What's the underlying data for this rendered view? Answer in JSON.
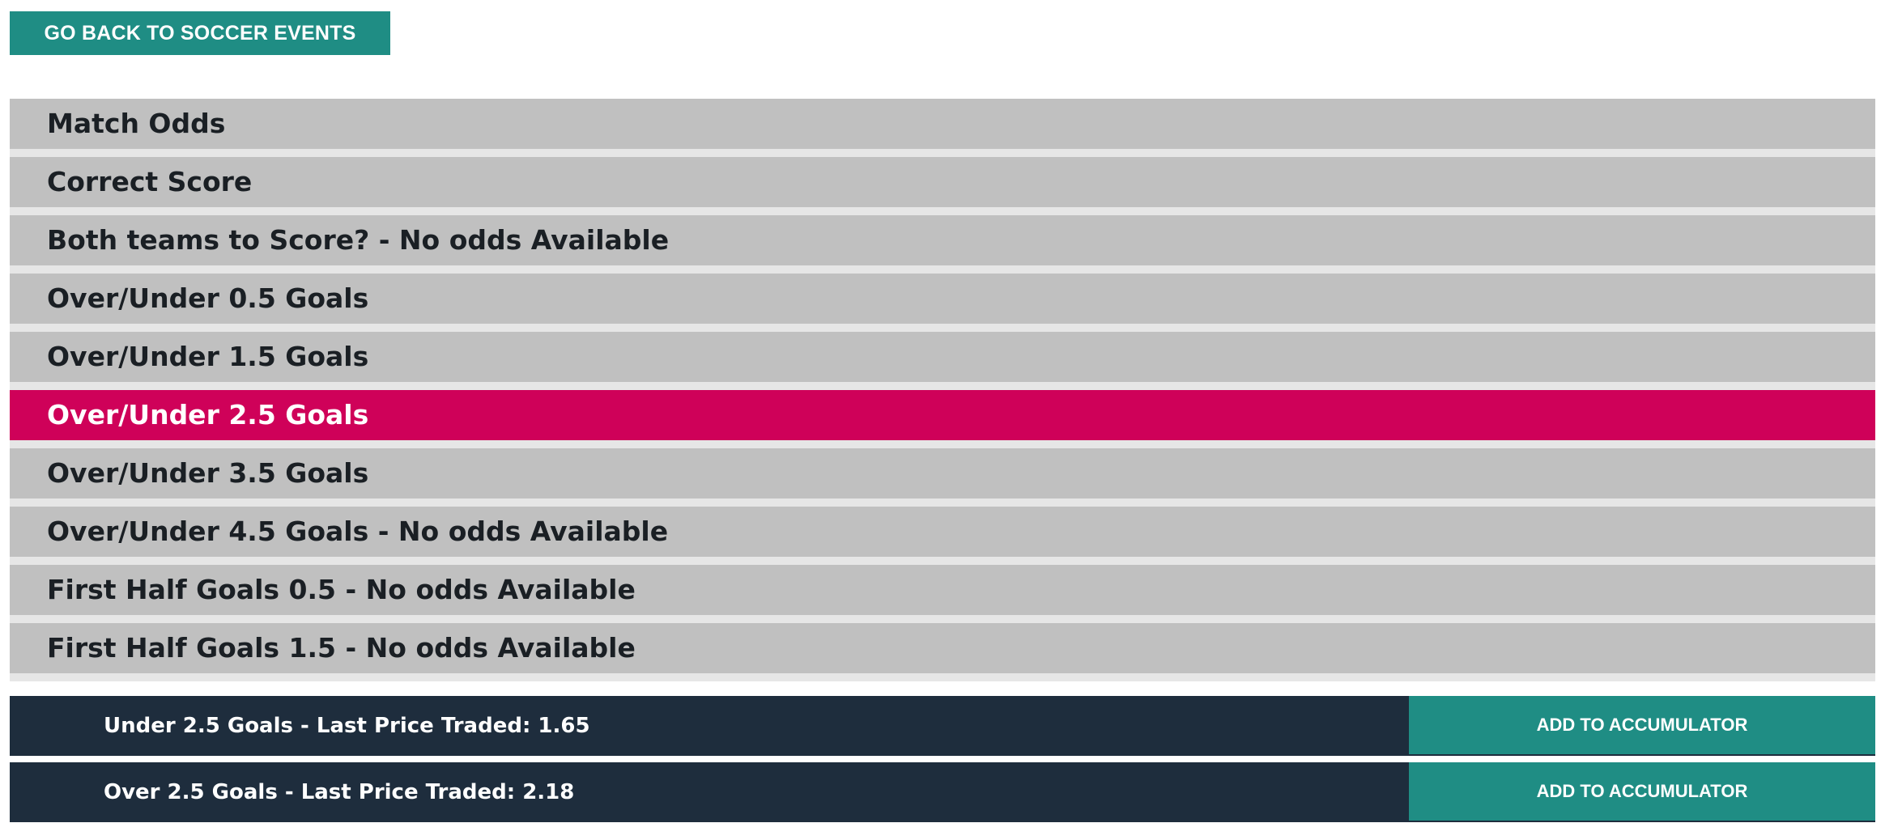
{
  "back_button": {
    "label": "GO BACK TO SOCCER EVENTS"
  },
  "markets": {
    "items": [
      {
        "label": "Match Odds",
        "selected": false
      },
      {
        "label": "Correct Score",
        "selected": false
      },
      {
        "label": "Both teams to Score? - No odds Available",
        "selected": false
      },
      {
        "label": "Over/Under 0.5 Goals",
        "selected": false
      },
      {
        "label": "Over/Under 1.5 Goals",
        "selected": false
      },
      {
        "label": "Over/Under 2.5 Goals",
        "selected": true
      },
      {
        "label": "Over/Under 3.5 Goals",
        "selected": false
      },
      {
        "label": "Over/Under 4.5 Goals - No odds Available",
        "selected": false
      },
      {
        "label": "First Half Goals 0.5 - No odds Available",
        "selected": false
      },
      {
        "label": "First Half Goals 1.5 - No odds Available",
        "selected": false
      }
    ]
  },
  "runners": [
    {
      "label": "Under 2.5 Goals - Last Price Traded: 1.65",
      "button_label": "ADD TO ACCUMULATOR"
    },
    {
      "label": "Over 2.5 Goals - Last Price Traded: 2.18",
      "button_label": "ADD TO ACCUMULATOR"
    }
  ],
  "colors": {
    "accent_teal": "#1f8d84",
    "selected_market": "#cf0159",
    "market_item_bg": "#c0c0c0",
    "runner_row_bg": "#1e2d3d"
  }
}
